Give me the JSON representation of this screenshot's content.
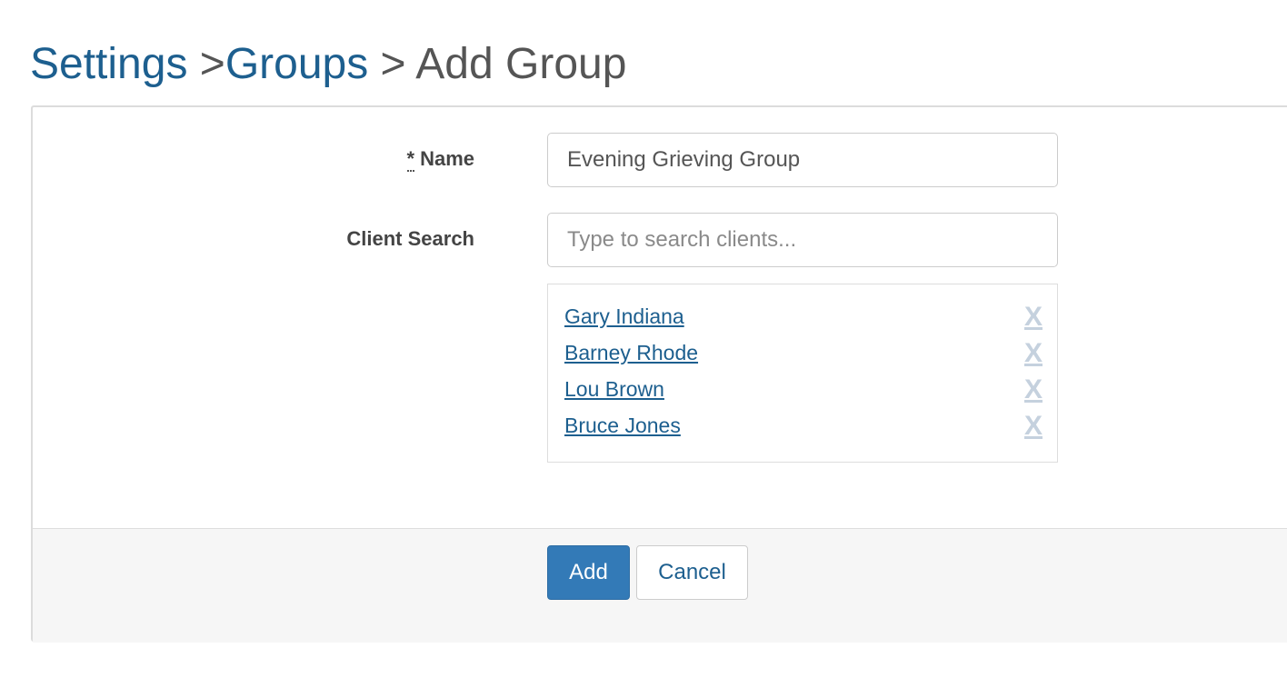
{
  "breadcrumb": {
    "settings": "Settings",
    "sep1": " >",
    "groups": "Groups",
    "sep2": " > ",
    "current": "Add Group"
  },
  "form": {
    "name_required_mark": "*",
    "name_label": "Name",
    "name_value": "Evening Grieving Group",
    "client_search_label": "Client Search",
    "client_search_placeholder": "Type to search clients...",
    "client_search_value": "",
    "clients": [
      {
        "name": "Gary Indiana",
        "remove": "X"
      },
      {
        "name": "Barney Rhode",
        "remove": "X"
      },
      {
        "name": "Lou Brown",
        "remove": "X"
      },
      {
        "name": "Bruce Jones",
        "remove": "X"
      }
    ]
  },
  "buttons": {
    "add_label": "Add",
    "cancel_label": "Cancel"
  },
  "colors": {
    "link": "#1d5f8f",
    "primary": "#337ab7",
    "remove": "#c5d1de"
  }
}
